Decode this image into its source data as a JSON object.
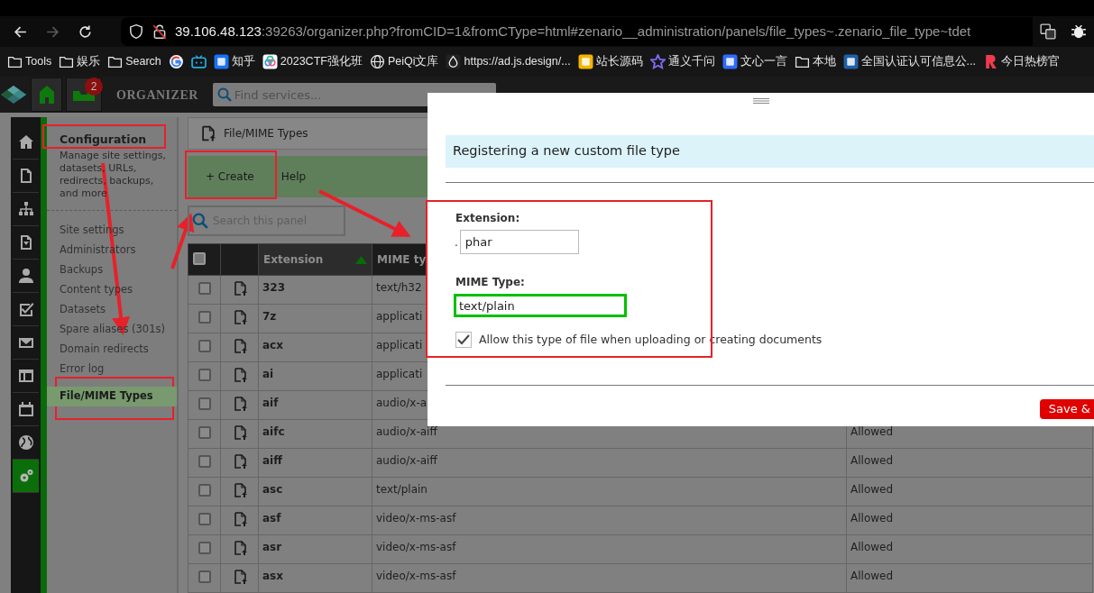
{
  "browser": {
    "nav_buttons": [
      {
        "kind": "back",
        "disabled": false
      },
      {
        "kind": "forward",
        "disabled": true
      },
      {
        "kind": "reload",
        "disabled": false
      }
    ],
    "address": {
      "host": "39.106.48.123",
      "rest": ":39263/organizer.php?fromCID=1&fromCType=html#zenario__administration/panels/file_types~.zenario_file_type~tdet"
    },
    "bookmarks": [
      {
        "kind": "folder",
        "label": "Tools"
      },
      {
        "kind": "folder",
        "label": "娱乐"
      },
      {
        "kind": "folder",
        "label": "Search"
      },
      {
        "kind": "google"
      },
      {
        "kind": "tv"
      },
      {
        "kind": "square",
        "color": "#1772f6",
        "label": "知乎"
      },
      {
        "kind": "cloud",
        "label": "2023CTF强化班"
      },
      {
        "kind": "globe",
        "label": "PeiQi文库"
      },
      {
        "kind": "drop",
        "label": "https://ad.js.design/..."
      },
      {
        "kind": "square",
        "color": "#f5b400",
        "label": "站长源码"
      },
      {
        "kind": "star",
        "label": "通义千问"
      },
      {
        "kind": "square",
        "color": "#2f6bff",
        "label": "文心一言"
      },
      {
        "kind": "folder",
        "label": "本地"
      },
      {
        "kind": "square",
        "color": "#1d5fa8",
        "label": "全国认证认可信息公..."
      },
      {
        "kind": "r",
        "label": "今日热榜官"
      }
    ]
  },
  "organizer": {
    "badge": "2",
    "title": "ORGANIZER",
    "search_placeholder": "Find services..."
  },
  "rail": [
    {
      "kind": "home",
      "selected": false
    },
    {
      "kind": "page",
      "selected": false
    },
    {
      "kind": "sitemap",
      "selected": false
    },
    {
      "kind": "download",
      "selected": false
    },
    {
      "kind": "person",
      "selected": false
    },
    {
      "kind": "check",
      "selected": false
    },
    {
      "kind": "mail",
      "selected": false
    },
    {
      "kind": "layout",
      "selected": false
    },
    {
      "kind": "calendar",
      "selected": false
    },
    {
      "kind": "globe",
      "selected": false
    },
    {
      "kind": "gears",
      "selected": true
    }
  ],
  "section": {
    "title": "Configuration",
    "description": "Manage site settings, datasets, URLs, redirects, backups, and more",
    "menu": [
      {
        "label": "Site settings",
        "selected": false
      },
      {
        "label": "Administrators",
        "selected": false
      },
      {
        "label": "Backups",
        "selected": false
      },
      {
        "label": "Content types",
        "selected": false
      },
      {
        "label": "Datasets",
        "selected": false
      },
      {
        "label": "Spare aliases (301s)",
        "selected": false
      },
      {
        "label": "Domain redirects",
        "selected": false
      },
      {
        "label": "Error log",
        "selected": false
      },
      {
        "label": "File/MIME Types",
        "selected": true
      }
    ]
  },
  "panel": {
    "title": "File/MIME Types",
    "toolbar": [
      "+ Create",
      "Help"
    ],
    "search_placeholder": "Search this panel",
    "select_all": {
      "checked": false
    },
    "columns": [
      {
        "label": "Extension",
        "sorted": true
      },
      {
        "label": "MIME ty",
        "sorted": false
      }
    ],
    "rows": [
      {
        "extension": "323",
        "mime": "text/h32",
        "checked": false
      },
      {
        "extension": "7z",
        "mime": "applicati",
        "checked": false
      },
      {
        "extension": "acx",
        "mime": "applicati",
        "checked": false
      },
      {
        "extension": "ai",
        "mime": "applicati",
        "checked": false
      },
      {
        "extension": "aif",
        "mime": "audio/x-a",
        "checked": false
      },
      {
        "extension": "aifc",
        "mime": "audio/x-aiff",
        "status": "Allowed",
        "checked": false
      },
      {
        "extension": "aiff",
        "mime": "audio/x-aiff",
        "status": "Allowed",
        "checked": false
      },
      {
        "extension": "asc",
        "mime": "text/plain",
        "status": "Allowed",
        "checked": false
      },
      {
        "extension": "asf",
        "mime": "video/x-ms-asf",
        "status": "Allowed",
        "checked": false
      },
      {
        "extension": "asr",
        "mime": "video/x-ms-asf",
        "status": "Allowed",
        "checked": false
      },
      {
        "extension": "asx",
        "mime": "video/x-ms-asf",
        "status": "Allowed",
        "checked": false
      }
    ]
  },
  "dialog": {
    "title": "Registering a new custom file type",
    "fields": [
      {
        "label": "Extension:",
        "prefix": ".",
        "value": "phar",
        "focused": false
      },
      {
        "label": "MIME Type:",
        "value": "text/plain",
        "focused": true
      }
    ],
    "checkbox": {
      "label": "Allow this type of file when uploading or creating documents",
      "checked": true
    },
    "button": "Save &"
  }
}
